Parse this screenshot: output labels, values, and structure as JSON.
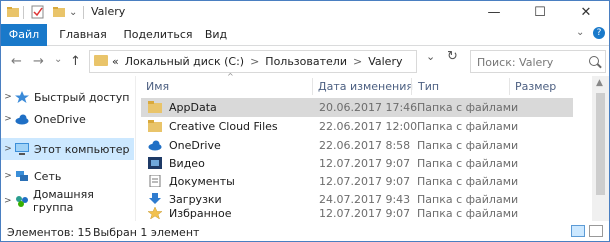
{
  "window": {
    "title": "Valery",
    "minimize": "—",
    "maximize": "☐",
    "close": "✕"
  },
  "ribbon": {
    "tabs": [
      "Файл",
      "Главная",
      "Поделиться",
      "Вид"
    ],
    "expand": "⌄",
    "help": "?"
  },
  "nav": {
    "back": "←",
    "forward": "→",
    "history": "⌄",
    "up": "↑"
  },
  "address": {
    "prefix": "«",
    "crumbs": [
      "Локальный диск (C:)",
      "Пользователи",
      "Valery"
    ],
    "separator": ">",
    "dropdown": "⌄",
    "refresh": "↻"
  },
  "search": {
    "placeholder": "Поиск: Valery"
  },
  "navpane": {
    "items": [
      {
        "label": "Быстрый доступ",
        "icon": "star-icon"
      },
      {
        "label": "OneDrive",
        "icon": "cloud-icon"
      },
      {
        "label": "Этот компьютер",
        "icon": "computer-icon",
        "selected": true
      },
      {
        "label": "Сеть",
        "icon": "network-icon"
      },
      {
        "label": "Домашняя группа",
        "icon": "homegroup-icon"
      }
    ]
  },
  "columns": {
    "name": "Имя",
    "date": "Дата изменения",
    "type": "Тип",
    "size": "Размер"
  },
  "files": [
    {
      "name": "AppData",
      "date": "20.06.2017 17:46",
      "type": "Папка с файлами",
      "icon": "folder-icon",
      "highlighted": true
    },
    {
      "name": "Creative Cloud Files",
      "date": "22.06.2017 12:00",
      "type": "Папка с файлами",
      "icon": "folder-icon"
    },
    {
      "name": "OneDrive",
      "date": "22.06.2017 8:58",
      "type": "Папка с файлами",
      "icon": "cloud-icon"
    },
    {
      "name": "Видео",
      "date": "12.07.2017 9:07",
      "type": "Папка с файлами",
      "icon": "video-folder-icon"
    },
    {
      "name": "Документы",
      "date": "12.07.2017 9:07",
      "type": "Папка с файлами",
      "icon": "documents-folder-icon"
    },
    {
      "name": "Загрузки",
      "date": "24.07.2017 9:43",
      "type": "Папка с файлами",
      "icon": "downloads-folder-icon"
    },
    {
      "name": "Избранное",
      "date": "12.07.2017 9:07",
      "type": "Папка с файлами",
      "icon": "favorites-folder-icon"
    }
  ],
  "status": {
    "count": "Элементов: 15",
    "selected": "Выбран 1 элемент"
  },
  "colors": {
    "accent": "#1979ca",
    "folder": "#e9c46a",
    "selection": "#cce8ff",
    "row_highlight": "#d9d9d9"
  }
}
